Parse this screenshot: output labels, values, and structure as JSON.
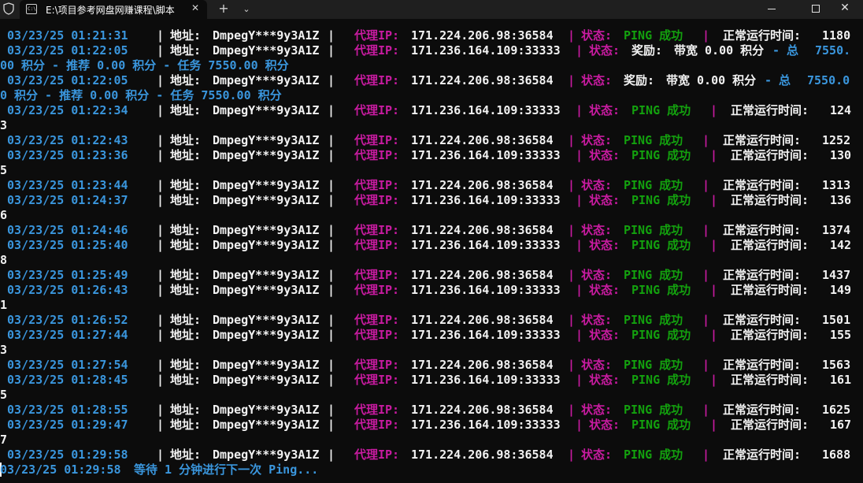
{
  "window": {
    "tab_title": "E:\\项目参考网盘网赚课程\\脚本",
    "tab_icon_text": "C:\\",
    "new_tab": "+",
    "dropdown": "⌄",
    "close_tab": "✕",
    "minimize": "",
    "maximize": "",
    "close": "✕"
  },
  "labels": {
    "sep": "|",
    "addr": "地址:",
    "proxy": "代理IP:",
    "status": "状态:",
    "ping_ok": "PING 成功",
    "uptime": "正常运行时间:",
    "reward": "奖励:",
    "bandwidth": "带宽 0.00 积分",
    "total_dash": "- 总",
    "referral": "积分 - 推荐 0.00 积分 - 任务 7550.00 积分"
  },
  "address": "DmpegY***9y3A1Z",
  "rows": [
    {
      "time": "03/23/25 01:21:31",
      "ip": "171.224.206.98:36584",
      "uptime": "1180"
    },
    {
      "time": "03/23/25 01:22:05",
      "ip": "171.236.164.109:33333",
      "total_head": "7550.",
      "total_tail": "00"
    },
    {
      "time": "03/23/25 01:22:05",
      "ip": "171.224.206.98:36584",
      "total_head": "7550.0",
      "total_tail": "0"
    },
    {
      "time": "03/23/25 01:22:34",
      "ip": "171.236.164.109:33333",
      "uptime": "124",
      "wrap": "3"
    },
    {
      "time": "03/23/25 01:22:43",
      "ip": "171.224.206.98:36584",
      "uptime": "1252"
    },
    {
      "time": "03/23/25 01:23:36",
      "ip": "171.236.164.109:33333",
      "uptime": "130",
      "wrap": "5"
    },
    {
      "time": "03/23/25 01:23:44",
      "ip": "171.224.206.98:36584",
      "uptime": "1313"
    },
    {
      "time": "03/23/25 01:24:37",
      "ip": "171.236.164.109:33333",
      "uptime": "136",
      "wrap": "6"
    },
    {
      "time": "03/23/25 01:24:46",
      "ip": "171.224.206.98:36584",
      "uptime": "1374"
    },
    {
      "time": "03/23/25 01:25:40",
      "ip": "171.236.164.109:33333",
      "uptime": "142",
      "wrap": "8"
    },
    {
      "time": "03/23/25 01:25:49",
      "ip": "171.224.206.98:36584",
      "uptime": "1437"
    },
    {
      "time": "03/23/25 01:26:43",
      "ip": "171.236.164.109:33333",
      "uptime": "149",
      "wrap": "1"
    },
    {
      "time": "03/23/25 01:26:52",
      "ip": "171.224.206.98:36584",
      "uptime": "1501"
    },
    {
      "time": "03/23/25 01:27:44",
      "ip": "171.236.164.109:33333",
      "uptime": "155",
      "wrap": "3"
    },
    {
      "time": "03/23/25 01:27:54",
      "ip": "171.224.206.98:36584",
      "uptime": "1563"
    },
    {
      "time": "03/23/25 01:28:45",
      "ip": "171.236.164.109:33333",
      "uptime": "161",
      "wrap": "5"
    },
    {
      "time": "03/23/25 01:28:55",
      "ip": "171.224.206.98:36584",
      "uptime": "1625"
    },
    {
      "time": "03/23/25 01:29:47",
      "ip": "171.236.164.109:33333",
      "uptime": "167",
      "wrap": "7"
    },
    {
      "time": "03/23/25 01:29:58",
      "ip": "171.224.206.98:36584",
      "uptime": "1688"
    }
  ],
  "footer": {
    "time": "03/23/25 01:29:58",
    "message": "等待 1 分钟进行下一次 Ping..."
  },
  "colors": {
    "time": "#3a96dd",
    "text": "#f2f2f2",
    "label": "#c81ba0",
    "success": "#13a10e",
    "info": "#3a96dd",
    "background": "#0c0c0c"
  }
}
